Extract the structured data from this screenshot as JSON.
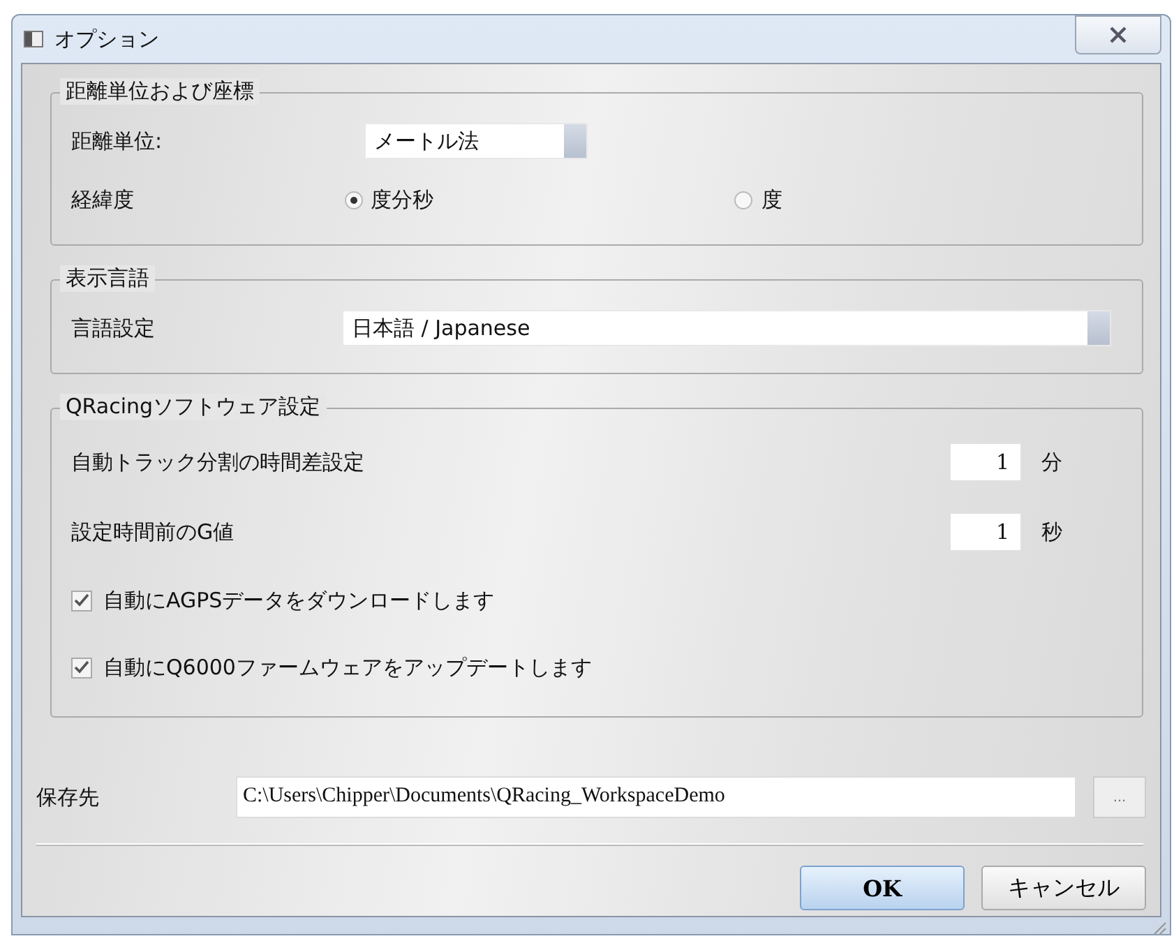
{
  "window": {
    "title": "オプション"
  },
  "distance_group": {
    "legend": "距離単位および座標",
    "unit_label": "距離単位:",
    "unit_value": "メートル法",
    "coord_label": "経緯度",
    "coord_options": [
      {
        "label": "度分秒",
        "selected": true
      },
      {
        "label": "度",
        "selected": false
      }
    ]
  },
  "language_group": {
    "legend": "表示言語",
    "label": "言語設定",
    "value": "日本語 / Japanese"
  },
  "software_group": {
    "legend": "QRacingソフトウェア設定",
    "spin_rows": [
      {
        "label": "自動トラック分割の時間差設定",
        "value": "1",
        "unit": "分"
      },
      {
        "label": "設定時間前のG値",
        "value": "1",
        "unit": "秒"
      }
    ],
    "checkboxes": [
      {
        "label": "自動にAGPSデータをダウンロードします",
        "checked": true
      },
      {
        "label": "自動にQ6000ファームウェアをアップデートします",
        "checked": true
      }
    ]
  },
  "save": {
    "label": "保存先",
    "value": "C:\\Users\\Chipper\\Documents\\QRacing_WorkspaceDemo",
    "browse": "..."
  },
  "buttons": [
    {
      "label": "OK",
      "default": true
    },
    {
      "label": "キャンセル",
      "default": false
    }
  ]
}
